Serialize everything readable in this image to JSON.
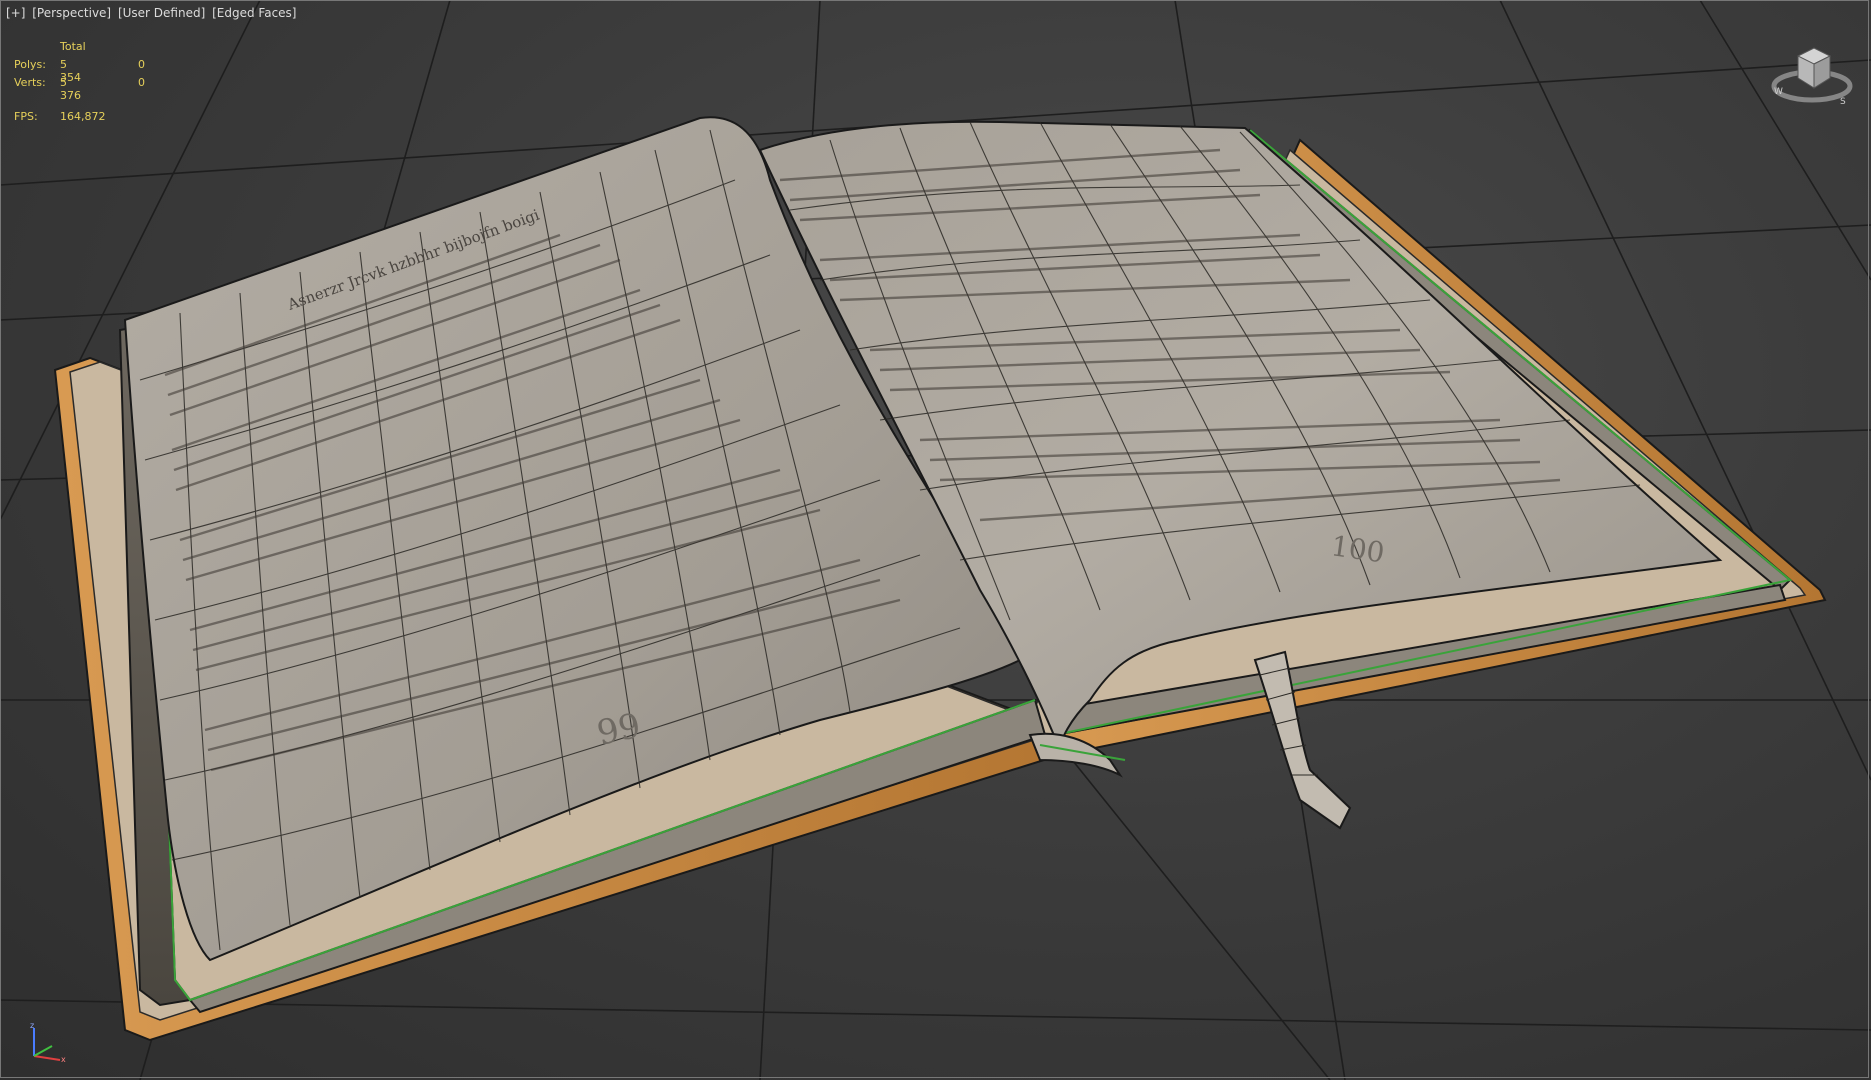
{
  "viewport": {
    "label_items": [
      "[+]",
      "[Perspective]",
      "[User Defined]",
      "[Edged Faces]"
    ]
  },
  "stats": {
    "header": "Total",
    "polys_label": "Polys:",
    "polys_value": "5 354",
    "polys_sel": "0",
    "verts_label": "Verts:",
    "verts_value": "5 376",
    "verts_sel": "0",
    "fps_label": "FPS:",
    "fps_value": "164,872"
  },
  "book": {
    "left_page_number": "99",
    "right_page_number": "100",
    "left_heading": "Asnerzr Jrcvk hzbbhr bijbojfn boigi"
  },
  "colors": {
    "background": "#3a3a3a",
    "grid_line": "#1c1c1c",
    "stats_text": "#e6d05a",
    "page": "#a9a39a",
    "cover_edge": "#c98a3e",
    "wire_green": "#3aa33a"
  }
}
